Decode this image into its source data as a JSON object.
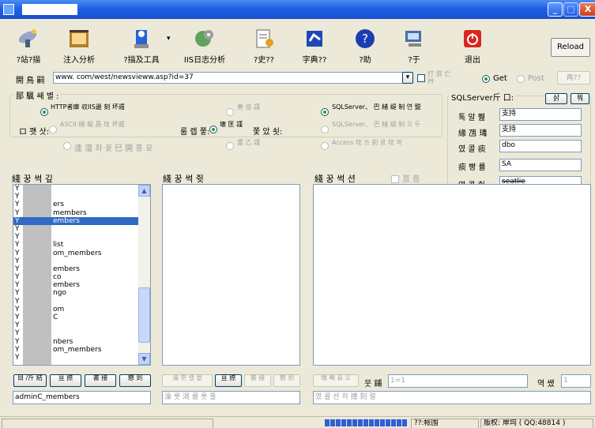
{
  "window": {
    "title": ""
  },
  "toolbar": {
    "items": [
      {
        "label": "?站?描",
        "icon": "satellite-icon"
      },
      {
        "label": "注入分析",
        "icon": "film-icon"
      },
      {
        "label": "?描及工具",
        "icon": "user-tool-icon"
      },
      {
        "label": "IIS日志分析",
        "icon": "globe-gear-icon"
      },
      {
        "label": "?史??",
        "icon": "history-icon"
      },
      {
        "label": "字典??",
        "icon": "dictionary-icon"
      },
      {
        "label": "?助",
        "icon": "help-icon"
      },
      {
        "label": "?于",
        "icon": "about-icon"
      },
      {
        "label": "退出",
        "icon": "power-icon"
      }
    ],
    "reload_label": "Reload"
  },
  "address": {
    "label": "開 鳥 嗣",
    "value": "www.           com/west/newsvieww.asp?id=37",
    "check_label": "打 浪 亡 卅",
    "get_label": "Get",
    "post_label": "Post",
    "retry_label": "再??"
  },
  "options": {
    "group_label": "郚 颿 쌔 별 :",
    "row1": {
      "a": "HTTP者庫 収IIS邊 刻 坏遁",
      "b": "善 佳 謹",
      "c": "SQLServer、 巴 緒 缇 制 연 盟"
    },
    "row2_label": "ロ 꽷 삿:",
    "row2": {
      "a": "ASCII 緒 報 昌 坟 坏遁",
      "mid_label": "룸 렙 쭣:",
      "b": "壊 匡 謹",
      "b2": "쫓 았 쇳:",
      "c": "SQLServer、 巴 緒 缇 制 으 두"
    },
    "row3": {
      "a": "逢 澶 좌 꽂 巳 開 홍 꾜",
      "b": "重 乙 謹",
      "c": "Access 坟 쓰 刹 쿵 坟 꽉"
    }
  },
  "sqlserver": {
    "label": "SQLServer斤 口:",
    "btn1": "삵",
    "btn2": "뭐",
    "fields": [
      {
        "label": "톡 말 쮎",
        "value": "支持"
      },
      {
        "label": "緣 乪 瑇",
        "value": "支持"
      },
      {
        "label": "였 콜 痰",
        "value": "dbo"
      },
      {
        "label": "痰 빵 률",
        "value": "SA"
      },
      {
        "label": "였 콜 췃",
        "value": "seatlie"
      }
    ]
  },
  "lists": {
    "left_title": "綫 꿍 썩 깊",
    "mid_title": "綫 꿍 썩 쥣",
    "right_title": "綫 꿍 썩 션",
    "right_check": "亘 쯤",
    "left_items": [
      "Y",
      "Y",
      "Yers",
      "Y members",
      "Y embers",
      "Y",
      "Y",
      "Y list",
      "Y om_members",
      "Y",
      "Y embers",
      "Y co",
      "Y embers",
      "Y ngo",
      "Y",
      "Y om",
      "Y C",
      "Y",
      "Y",
      "Y nbers",
      "Y om_members",
      "Y"
    ]
  },
  "bottom": {
    "left_btns": [
      "目 /斤 結",
      "亘 捺",
      "書 接",
      "懇 到"
    ],
    "left_value": "adminC_members",
    "mid_btns": [
      "澡 뿐 캘 좔",
      "亘 捺",
      "書 接",
      "懇 到"
    ],
    "mid_field": "澡 룻 渴 룹 룻 졸",
    "right_btn": "填 뻬 흙 오",
    "right_label": "뭇 鋪",
    "right_input": "1=1",
    "right_label2": "역 쌨",
    "right_input2": "1",
    "right_field": "였 콜 션 저 撞 刻 렬"
  },
  "status": {
    "left": "",
    "mid": "??:帐围",
    "right": "版权: 岸坞 ( QQ:48814 )"
  }
}
